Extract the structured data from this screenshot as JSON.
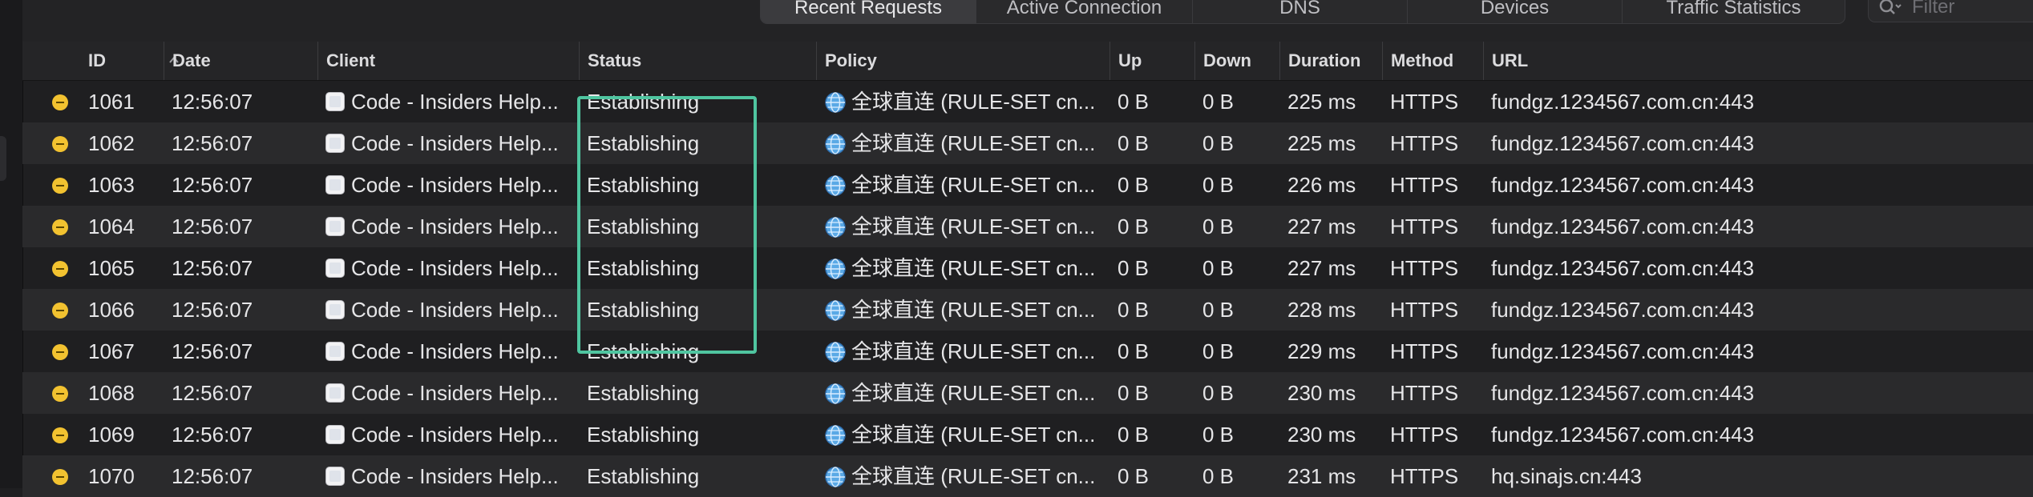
{
  "tabs": [
    "Recent Requests",
    "Active Connection",
    "DNS",
    "Devices",
    "Traffic Statistics"
  ],
  "filter": {
    "placeholder": "Filter"
  },
  "columns": {
    "id": "ID",
    "date": "Date",
    "client": "Client",
    "status": "Status",
    "policy": "Policy",
    "up": "Up",
    "down": "Down",
    "duration": "Duration",
    "method": "Method",
    "url": "URL"
  },
  "requests": [
    {
      "id": "1061",
      "date": "12:56:07",
      "client": "Code - Insiders Help...",
      "status": "Establishing",
      "policy": "全球直连 (RULE-SET cn...",
      "up": "0 B",
      "down": "0 B",
      "duration": "225 ms",
      "method": "HTTPS",
      "url": "fundgz.1234567.com.cn:443"
    },
    {
      "id": "1062",
      "date": "12:56:07",
      "client": "Code - Insiders Help...",
      "status": "Establishing",
      "policy": "全球直连 (RULE-SET cn...",
      "up": "0 B",
      "down": "0 B",
      "duration": "225 ms",
      "method": "HTTPS",
      "url": "fundgz.1234567.com.cn:443"
    },
    {
      "id": "1063",
      "date": "12:56:07",
      "client": "Code - Insiders Help...",
      "status": "Establishing",
      "policy": "全球直连 (RULE-SET cn...",
      "up": "0 B",
      "down": "0 B",
      "duration": "226 ms",
      "method": "HTTPS",
      "url": "fundgz.1234567.com.cn:443"
    },
    {
      "id": "1064",
      "date": "12:56:07",
      "client": "Code - Insiders Help...",
      "status": "Establishing",
      "policy": "全球直连 (RULE-SET cn...",
      "up": "0 B",
      "down": "0 B",
      "duration": "227 ms",
      "method": "HTTPS",
      "url": "fundgz.1234567.com.cn:443"
    },
    {
      "id": "1065",
      "date": "12:56:07",
      "client": "Code - Insiders Help...",
      "status": "Establishing",
      "policy": "全球直连 (RULE-SET cn...",
      "up": "0 B",
      "down": "0 B",
      "duration": "227 ms",
      "method": "HTTPS",
      "url": "fundgz.1234567.com.cn:443"
    },
    {
      "id": "1066",
      "date": "12:56:07",
      "client": "Code - Insiders Help...",
      "status": "Establishing",
      "policy": "全球直连 (RULE-SET cn...",
      "up": "0 B",
      "down": "0 B",
      "duration": "228 ms",
      "method": "HTTPS",
      "url": "fundgz.1234567.com.cn:443"
    },
    {
      "id": "1067",
      "date": "12:56:07",
      "client": "Code - Insiders Help...",
      "status": "Establishing",
      "policy": "全球直连 (RULE-SET cn...",
      "up": "0 B",
      "down": "0 B",
      "duration": "229 ms",
      "method": "HTTPS",
      "url": "fundgz.1234567.com.cn:443"
    },
    {
      "id": "1068",
      "date": "12:56:07",
      "client": "Code - Insiders Help...",
      "status": "Establishing",
      "policy": "全球直连 (RULE-SET cn...",
      "up": "0 B",
      "down": "0 B",
      "duration": "230 ms",
      "method": "HTTPS",
      "url": "fundgz.1234567.com.cn:443"
    },
    {
      "id": "1069",
      "date": "12:56:07",
      "client": "Code - Insiders Help...",
      "status": "Establishing",
      "policy": "全球直连 (RULE-SET cn...",
      "up": "0 B",
      "down": "0 B",
      "duration": "230 ms",
      "method": "HTTPS",
      "url": "fundgz.1234567.com.cn:443"
    },
    {
      "id": "1070",
      "date": "12:56:07",
      "client": "Code - Insiders Help...",
      "status": "Establishing",
      "policy": "全球直连 (RULE-SET cn...",
      "up": "0 B",
      "down": "0 B",
      "duration": "231 ms",
      "method": "HTTPS",
      "url": "hq.sinajs.cn:443"
    }
  ],
  "colors": {
    "background": "#1f1f21",
    "row_alt": "#2a2a2c",
    "status_dot": "#f2c230",
    "highlight_box": "#4fc5a0"
  },
  "icons": {
    "status": "pending-dot-icon",
    "client": "app-icon",
    "policy": "globe-icon",
    "sort": "chevron-up-icon",
    "filter": "search-icon"
  }
}
